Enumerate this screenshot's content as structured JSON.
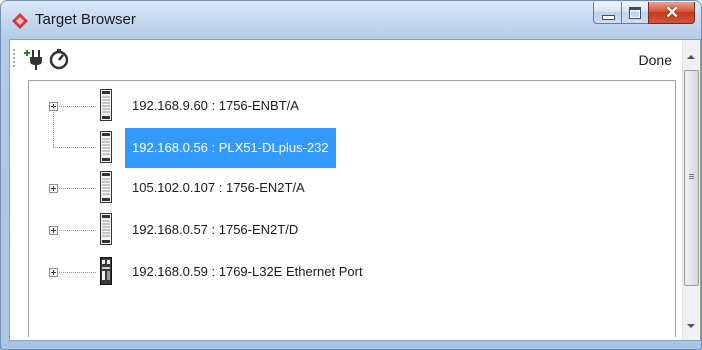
{
  "window": {
    "title": "Target Browser",
    "icon": "diamond-app-icon",
    "controls": [
      "minimize-icon",
      "maximize-icon",
      "close-icon"
    ]
  },
  "toolbar": {
    "add_icon": "add-plug-icon",
    "refresh_icon": "scan-refresh-icon",
    "done_label": "Done"
  },
  "tree": {
    "nodes": [
      {
        "label": "192.168.9.60 : 1756-ENBT/A",
        "expandable": true,
        "selected": false,
        "icon": "ethernet-module-icon"
      },
      {
        "label": "192.168.0.56 : PLX51-DLplus-232",
        "expandable": false,
        "selected": true,
        "icon": "ethernet-module-icon"
      },
      {
        "label": "105.102.0.107 : 1756-EN2T/A",
        "expandable": true,
        "selected": false,
        "icon": "ethernet-module-icon"
      },
      {
        "label": "192.168.0.57 : 1756-EN2T/D",
        "expandable": true,
        "selected": false,
        "icon": "ethernet-module-icon"
      },
      {
        "label": "192.168.0.59 : 1769-L32E Ethernet Port",
        "expandable": true,
        "selected": false,
        "icon": "controller-module-icon"
      }
    ]
  },
  "colors": {
    "selection": "#3399ff",
    "titlebar": "#c6d9f1",
    "close_button": "#c23b1c"
  }
}
